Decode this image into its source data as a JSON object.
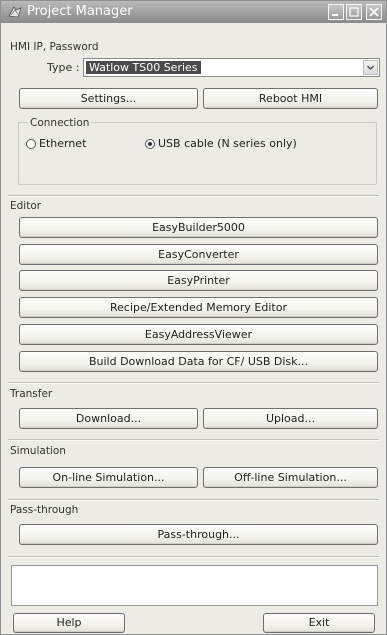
{
  "window": {
    "title": "Project Manager",
    "title_icon": "project-manager-app-icon"
  },
  "hmi": {
    "section_label": "HMI IP, Password",
    "type_label": "Type :",
    "type_value": "Watlow TS00 Series",
    "settings_label": "Settings...",
    "reboot_label": "Reboot HMI"
  },
  "connection": {
    "label": "Connection",
    "options": [
      {
        "label": "Ethernet",
        "selected": false
      },
      {
        "label": "USB cable (N series only)",
        "selected": true
      }
    ]
  },
  "editor": {
    "section_label": "Editor",
    "buttons": [
      "EasyBuilder5000",
      "EasyConverter",
      "EasyPrinter",
      "Recipe/Extended Memory Editor",
      "EasyAddressViewer",
      "Build Download Data for CF/ USB Disk..."
    ]
  },
  "transfer": {
    "section_label": "Transfer",
    "download_label": "Download...",
    "upload_label": "Upload..."
  },
  "simulation": {
    "section_label": "Simulation",
    "online_label": "On-line Simulation...",
    "offline_label": "Off-line Simulation..."
  },
  "passthrough": {
    "section_label": "Pass-through",
    "button_label": "Pass-through..."
  },
  "footer": {
    "help_label": "Help",
    "exit_label": "Exit"
  },
  "colors": {
    "window_bg": "#ecebe6",
    "titlebar": "#9a9a9a",
    "selection": "#4b4b4b"
  }
}
